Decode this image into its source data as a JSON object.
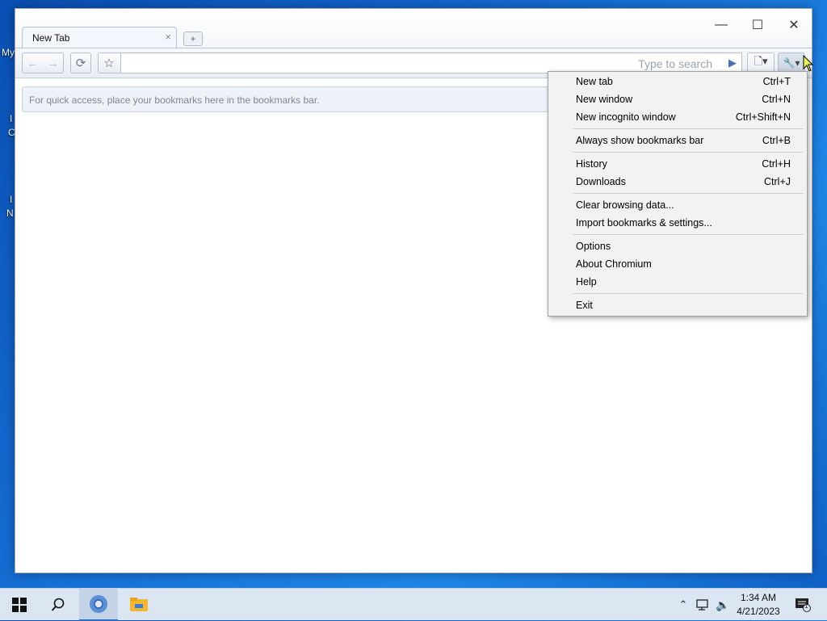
{
  "desktop": {
    "fragments": [
      "My",
      "I",
      "C",
      "I",
      "N"
    ]
  },
  "window": {
    "controls": {
      "minimize": "—",
      "maximize": "☐",
      "close": "✕"
    }
  },
  "tab": {
    "title": "New Tab",
    "close": "×",
    "new_tab": "+"
  },
  "toolbar": {
    "back": "←",
    "forward": "→",
    "reload": "⟳",
    "star": "☆",
    "omnibox_placeholder": "Type to search",
    "go": "▶",
    "page_menu": "🗋▾",
    "wrench_menu": "🔧▾"
  },
  "bookmarks_hint": "For quick access, place your bookmarks here in the bookmarks bar.",
  "menu": {
    "groups": [
      [
        {
          "label": "New tab",
          "shortcut": "Ctrl+T"
        },
        {
          "label": "New window",
          "shortcut": "Ctrl+N"
        },
        {
          "label": "New incognito window",
          "shortcut": "Ctrl+Shift+N"
        }
      ],
      [
        {
          "label": "Always show bookmarks bar",
          "shortcut": "Ctrl+B"
        }
      ],
      [
        {
          "label": "History",
          "shortcut": "Ctrl+H"
        },
        {
          "label": "Downloads",
          "shortcut": "Ctrl+J"
        }
      ],
      [
        {
          "label": "Clear browsing data...",
          "shortcut": ""
        },
        {
          "label": "Import bookmarks & settings...",
          "shortcut": ""
        }
      ],
      [
        {
          "label": "Options",
          "shortcut": ""
        },
        {
          "label": "About Chromium",
          "shortcut": ""
        },
        {
          "label": "Help",
          "shortcut": ""
        }
      ],
      [
        {
          "label": "Exit",
          "shortcut": ""
        }
      ]
    ]
  },
  "taskbar": {
    "time": "1:34 AM",
    "date": "4/21/2023",
    "notification_count": "1"
  },
  "colors": {
    "desktop": "#1670d6",
    "taskbar": "#dce6f2",
    "menu_bg": "#f2f2f2"
  }
}
